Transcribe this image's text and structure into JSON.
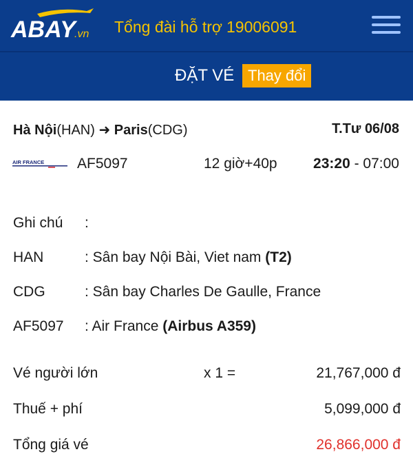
{
  "header": {
    "logo_text": "ABAY.vn",
    "hotline_label": "Tổng đài hỗ trợ",
    "hotline_number": "19006091"
  },
  "booking": {
    "title": "ĐẶT VÉ",
    "change_label": "Thay đổi"
  },
  "flight": {
    "origin_city": "Hà Nội",
    "origin_code": "(HAN)",
    "destination_city": "Paris",
    "destination_code": "(CDG)",
    "date": "T.Tư 06/08",
    "airline_logo": "AIR FRANCE",
    "flight_number": "AF5097",
    "duration": "12 giờ+40p",
    "depart_time": "23:20",
    "arrive_time": "- 07:00"
  },
  "notes": [
    {
      "label": "Ghi chú",
      "value": ":",
      "bold": ""
    },
    {
      "label": "HAN",
      "value": ": Sân bay Nội Bài, Viet nam",
      "bold": "(T2)"
    },
    {
      "label": "CDG",
      "value": ": Sân bay Charles De Gaulle, France",
      "bold": ""
    },
    {
      "label": "AF5097",
      "value": ":  Air France",
      "bold": "(Airbus A359)"
    }
  ],
  "pricing": {
    "adult_label": "Vé người lớn",
    "adult_multiplier": "x 1 =",
    "adult_price": "21,767,000 đ",
    "tax_label": "Thuế + phí",
    "tax_price": "5,099,000 đ",
    "total_label": "Tổng giá vé",
    "total_price": "26,866,000 đ"
  },
  "colors": {
    "header_bg": "#0b3d8c",
    "hotline": "#f5c300",
    "change_bg": "#f7a600",
    "total": "#e0302b"
  }
}
